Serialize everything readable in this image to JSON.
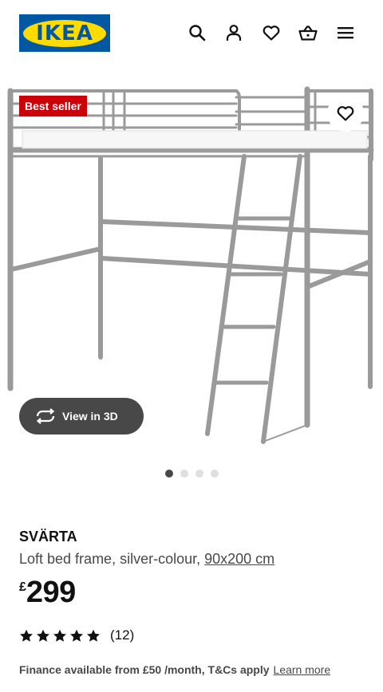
{
  "header": {
    "logo_text": "IKEA",
    "icons": [
      "search-icon",
      "account-icon",
      "favourites-icon",
      "basket-icon",
      "menu-icon"
    ]
  },
  "product_image": {
    "badge": "Best seller",
    "view_3d_label": "View in 3D",
    "gallery": {
      "total": 4,
      "active": 1
    }
  },
  "product": {
    "name": "SVÄRTA",
    "description": "Loft bed frame, silver-colour,",
    "size_link": "90x200 cm",
    "price_currency": "£",
    "price_value": "299",
    "rating": 5,
    "review_count": "(12)"
  },
  "finance": {
    "text": "Finance available from £50 /month, T&Cs apply",
    "link": "Learn more"
  },
  "colors": {
    "ikea_blue": "#0058a3",
    "ikea_yellow": "#ffdb00",
    "badge_red": "#cc0008",
    "frame_grey": "#9a9a9a"
  }
}
